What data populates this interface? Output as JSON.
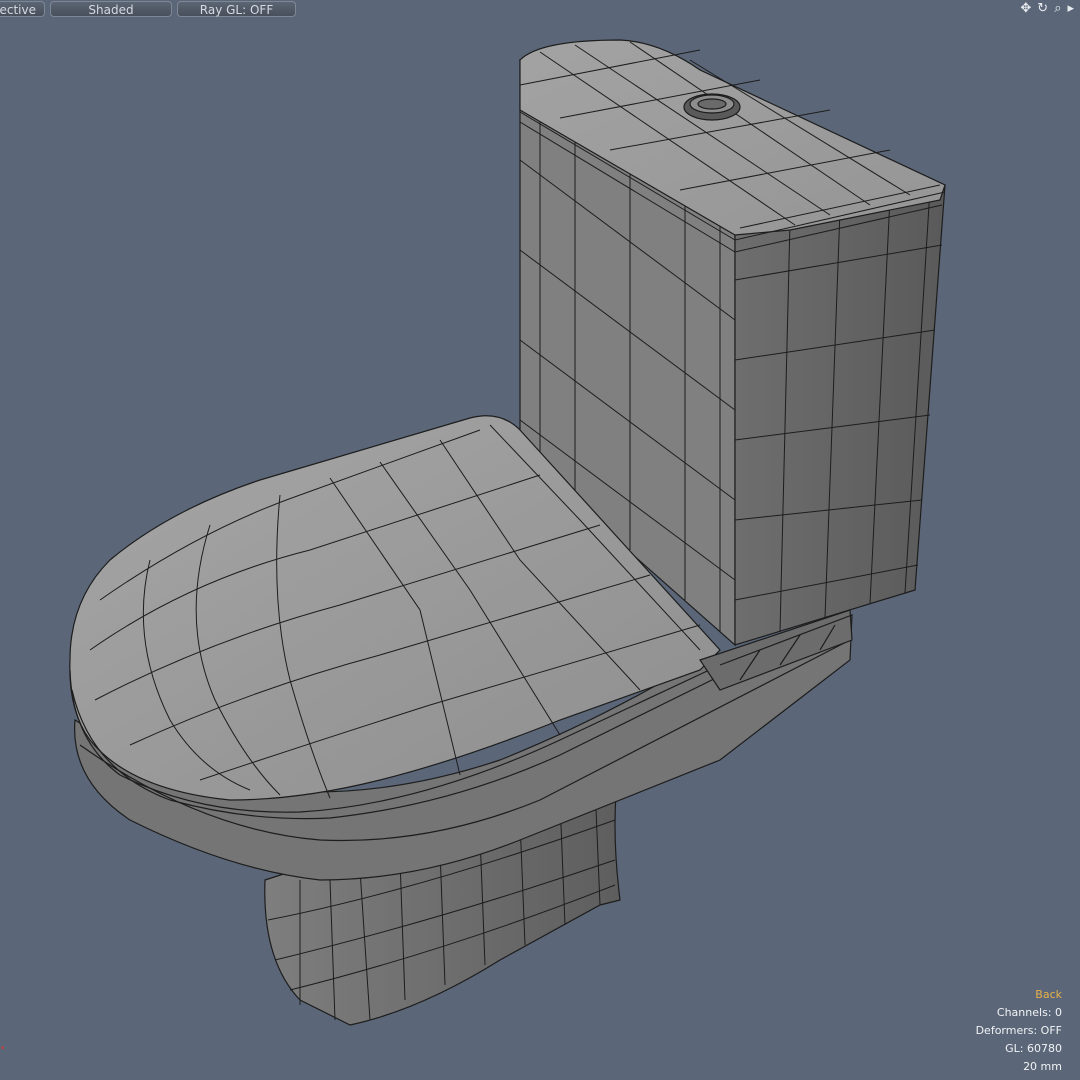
{
  "toolbar": {
    "projection_label": "ective",
    "shading_label": "Shaded",
    "raygl_label": "Ray GL: OFF"
  },
  "viewport_icons": [
    {
      "name": "pan-icon",
      "glyph": "✥"
    },
    {
      "name": "rotate-icon",
      "glyph": "↻"
    },
    {
      "name": "zoom-icon",
      "glyph": "⌕"
    },
    {
      "name": "expand-arrow-icon",
      "glyph": "▸"
    }
  ],
  "hud": {
    "view_name": "Back",
    "channels": "Channels: 0",
    "deformers": "Deformers: OFF",
    "gl": "GL: 60780",
    "units": "20 mm"
  },
  "colors": {
    "background": "#5b6778",
    "mesh_fill": "#8c8c8c",
    "mesh_wire": "#1d1d1d",
    "hud_accent": "#e8b04a"
  }
}
